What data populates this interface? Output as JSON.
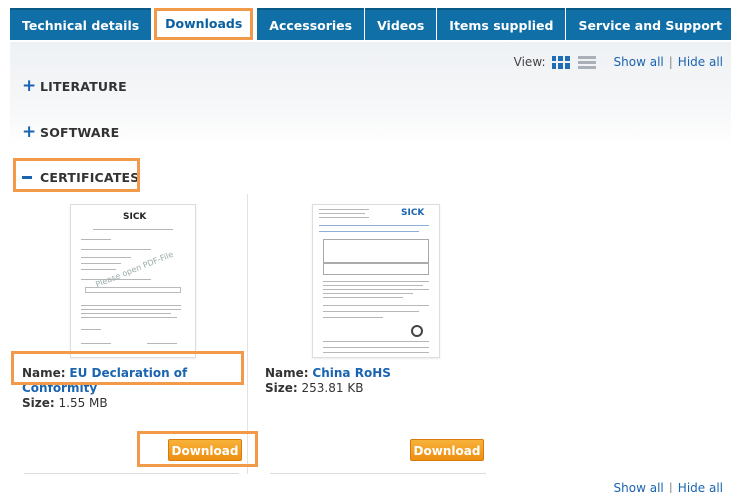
{
  "tabs": [
    "Technical details",
    "Downloads",
    "Accessories",
    "Videos",
    "Items supplied",
    "Service and Support"
  ],
  "active_tab": "Downloads",
  "view": {
    "label": "View:",
    "show_all": "Show all",
    "hide_all": "Hide all",
    "separator": "|"
  },
  "sections": {
    "literature": "LITERATURE",
    "software": "SOFTWARE",
    "certificates": "CERTIFICATES"
  },
  "cards": [
    {
      "name_label": "Name:",
      "name": "EU Declaration of Conformity",
      "size_label": "Size:",
      "size": "1.55 MB",
      "button": "Download",
      "thumb_logo": "SICK",
      "thumb_watermark": "Please open PDF-File"
    },
    {
      "name_label": "Name:",
      "name": "China RoHS",
      "size_label": "Size:",
      "size": "253.81 KB",
      "button": "Download",
      "thumb_logo": "SICK"
    }
  ],
  "bottom": {
    "show_all": "Show all",
    "hide_all": "Hide all",
    "separator": "|"
  },
  "colors": {
    "tab_bg": "#0f6fa6",
    "link": "#1a64b0",
    "button": "#ee8f12",
    "highlight": "#f39a4a"
  }
}
